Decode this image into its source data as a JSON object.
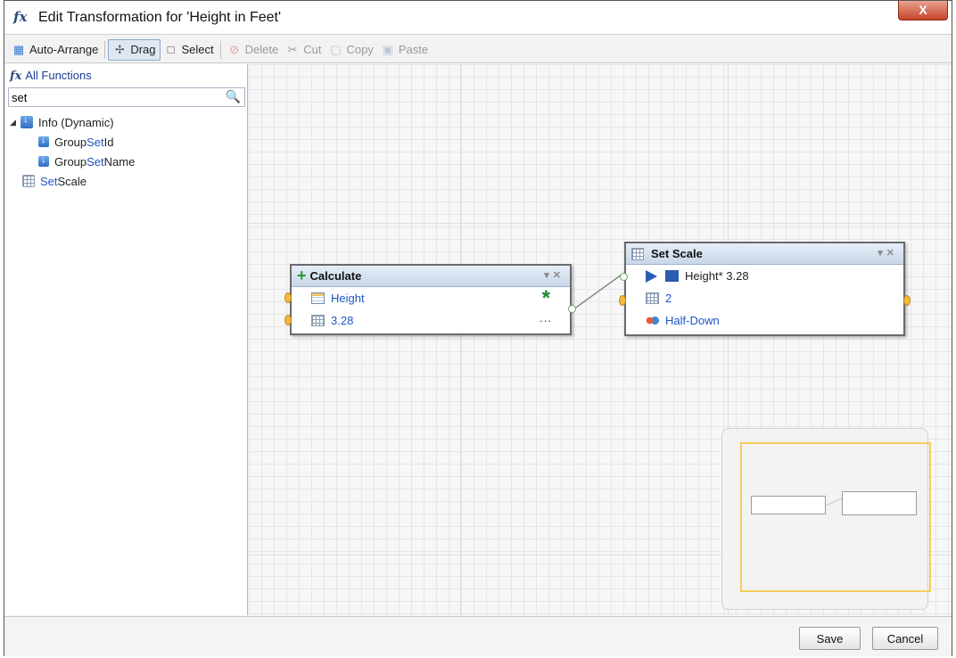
{
  "window": {
    "title": "Edit Transformation for 'Height in Feet'",
    "close_label": "X"
  },
  "toolbar": {
    "auto_arrange": "Auto-Arrange",
    "drag": "Drag",
    "select": "Select",
    "delete": "Delete",
    "cut": "Cut",
    "copy": "Copy",
    "paste": "Paste"
  },
  "left_panel": {
    "all_functions": "All Functions",
    "search_value": "set",
    "tree": {
      "root": "Info (Dynamic)",
      "children": [
        {
          "prefix": "Group ",
          "match": "Set",
          "suffix": " Id"
        },
        {
          "prefix": "Group ",
          "match": "Set",
          "suffix": " Name"
        }
      ],
      "set_scale": {
        "match": "Set",
        "suffix": " Scale"
      }
    }
  },
  "nodes": {
    "calculate": {
      "title": "Calculate",
      "rows": [
        "Height",
        "3.28"
      ],
      "operator": "*",
      "more": "..."
    },
    "set_scale": {
      "title": "Set Scale",
      "input_field": "Height",
      "input_expr": " * 3.28",
      "scale": "2",
      "rounding": "Half-Down"
    }
  },
  "footer": {
    "save": "Save",
    "cancel": "Cancel"
  }
}
